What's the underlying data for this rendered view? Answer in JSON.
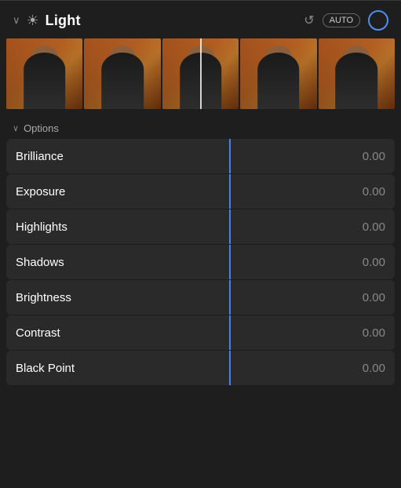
{
  "header": {
    "title": "Light",
    "auto_label": "AUTO",
    "chevron": "›",
    "colors": {
      "accent": "#4a7ef5",
      "background": "#1e1e1e",
      "row_bg": "#2a2a2a"
    }
  },
  "options": {
    "label": "Options"
  },
  "sliders": [
    {
      "id": "brilliance",
      "label": "Brilliance",
      "value": "0.00"
    },
    {
      "id": "exposure",
      "label": "Exposure",
      "value": "0.00"
    },
    {
      "id": "highlights",
      "label": "Highlights",
      "value": "0.00"
    },
    {
      "id": "shadows",
      "label": "Shadows",
      "value": "0.00"
    },
    {
      "id": "brightness",
      "label": "Brightness",
      "value": "0.00"
    },
    {
      "id": "contrast",
      "label": "Contrast",
      "value": "0.00"
    },
    {
      "id": "black-point",
      "label": "Black Point",
      "value": "0.00"
    }
  ]
}
